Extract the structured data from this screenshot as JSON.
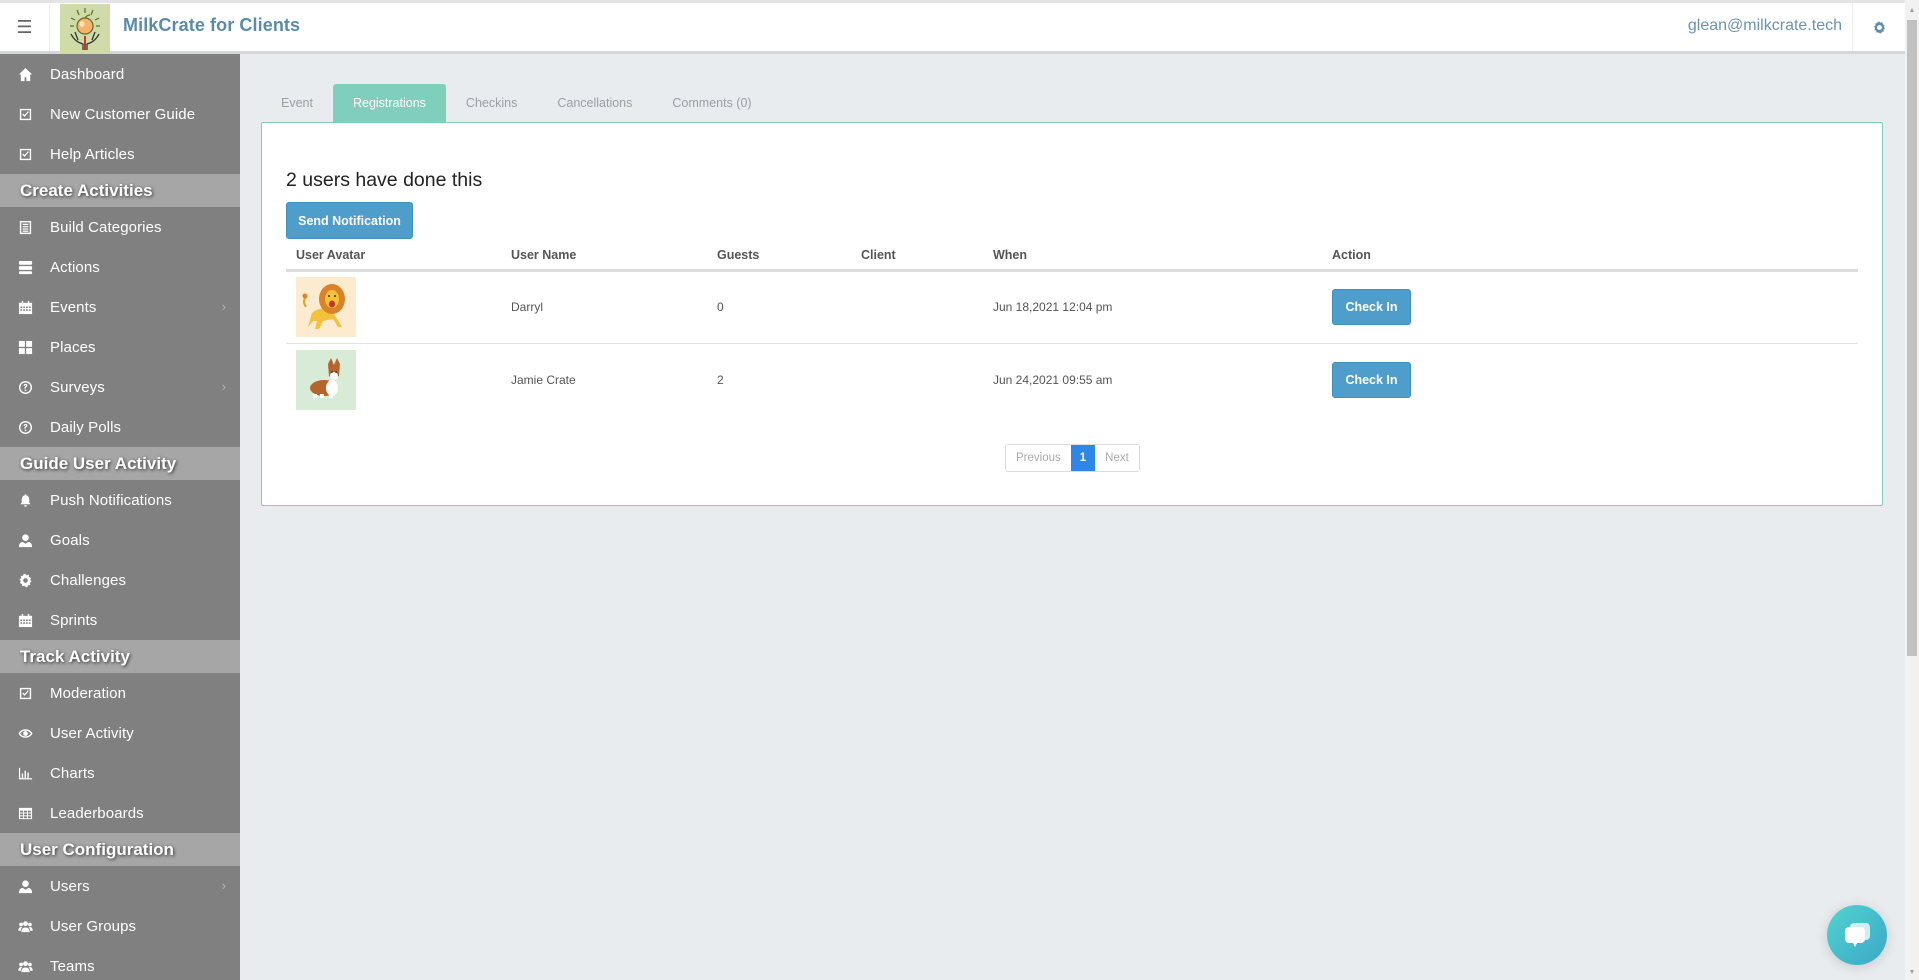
{
  "header": {
    "menu_icon": "hamburger-icon",
    "logo_icon": "apple-hands-logo",
    "app_title": "MilkCrate for Clients",
    "user_email": "glean@milkcrate.tech",
    "settings_icon": "gear-icon"
  },
  "sidebar": {
    "groups": [
      {
        "items": [
          {
            "label": "Dashboard",
            "icon": "home-icon"
          },
          {
            "label": "New Customer Guide",
            "icon": "checkbox-icon"
          },
          {
            "label": "Help Articles",
            "icon": "checkbox-icon"
          }
        ]
      },
      {
        "title": "Create Activities",
        "items": [
          {
            "label": "Build Categories",
            "icon": "list-icon"
          },
          {
            "label": "Actions",
            "icon": "tasks-icon"
          },
          {
            "label": "Events",
            "icon": "calendar-icon",
            "has_submenu": true
          },
          {
            "label": "Places",
            "icon": "grid-icon"
          },
          {
            "label": "Surveys",
            "icon": "question-circle-icon",
            "has_submenu": true
          },
          {
            "label": "Daily Polls",
            "icon": "question-circle-icon"
          }
        ]
      },
      {
        "title": "Guide User Activity",
        "items": [
          {
            "label": "Push Notifications",
            "icon": "bell-icon"
          },
          {
            "label": "Goals",
            "icon": "user-icon"
          },
          {
            "label": "Challenges",
            "icon": "cog-icon"
          },
          {
            "label": "Sprints",
            "icon": "calendar-icon"
          }
        ]
      },
      {
        "title": "Track Activity",
        "items": [
          {
            "label": "Moderation",
            "icon": "checkbox-icon"
          },
          {
            "label": "User Activity",
            "icon": "eye-icon"
          },
          {
            "label": "Charts",
            "icon": "bar-chart-icon"
          },
          {
            "label": "Leaderboards",
            "icon": "table-icon"
          }
        ]
      },
      {
        "title": "User Configuration",
        "items": [
          {
            "label": "Users",
            "icon": "user-icon",
            "has_submenu": true
          },
          {
            "label": "User Groups",
            "icon": "users-icon"
          },
          {
            "label": "Teams",
            "icon": "users-icon"
          }
        ]
      }
    ]
  },
  "tabs": [
    {
      "label": "Event",
      "active": false
    },
    {
      "label": "Registrations",
      "active": true
    },
    {
      "label": "Checkins",
      "active": false
    },
    {
      "label": "Cancellations",
      "active": false
    },
    {
      "label": "Comments (0)",
      "active": false
    }
  ],
  "panel": {
    "title": "2 users have done this",
    "send_button": "Send Notification",
    "columns": [
      "User Avatar",
      "User Name",
      "Guests",
      "Client",
      "When",
      "Action"
    ],
    "rows": [
      {
        "avatar": "lion-avatar",
        "name": "Darryl",
        "guests": "0",
        "client": "",
        "when": "Jun 18,2021 12:04 pm",
        "action": "Check In"
      },
      {
        "avatar": "corgi-avatar",
        "name": "Jamie Crate",
        "guests": "2",
        "client": "",
        "when": "Jun 24,2021 09:55 am",
        "action": "Check In"
      }
    ],
    "pagination": {
      "previous": "Previous",
      "current": "1",
      "next": "Next"
    }
  },
  "chat_widget": {
    "icon": "chat-bubbles-icon"
  },
  "colors": {
    "accent_teal": "#80cfbc",
    "button_blue": "#4e9dcb",
    "page_current": "#2c87e6",
    "sidebar_bg": "#808080",
    "section_bg": "#a6a6a6",
    "brand_text": "#5a8bab"
  }
}
